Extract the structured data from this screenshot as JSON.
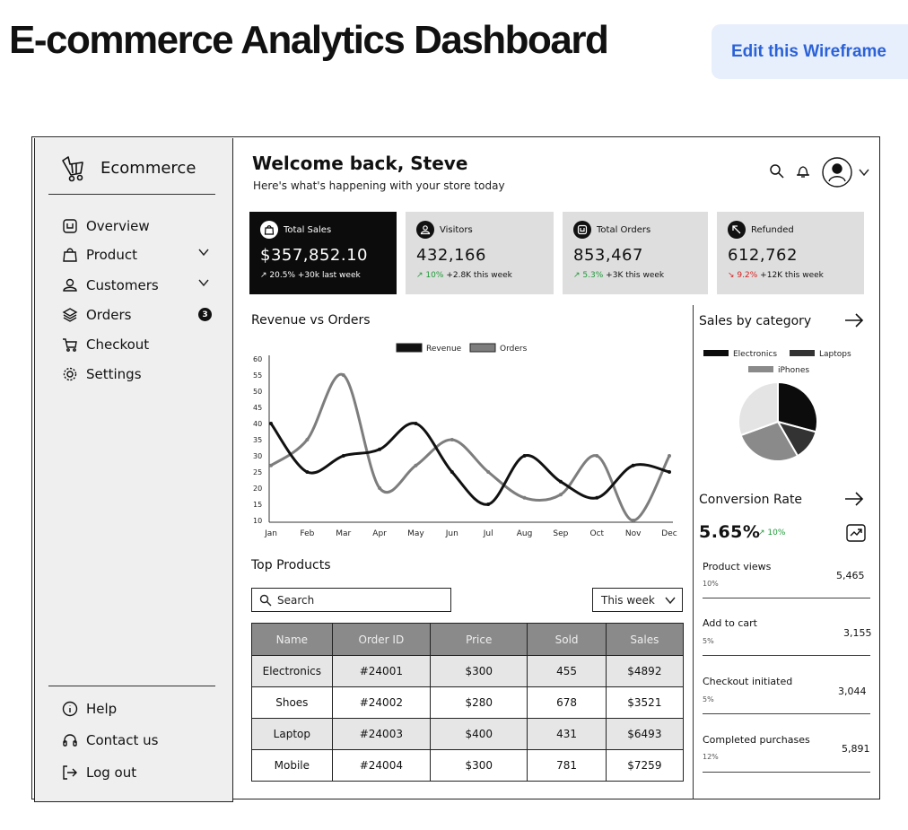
{
  "page": {
    "title": "E-commerce Analytics Dashboard",
    "edit_button": "Edit this Wireframe"
  },
  "sidebar": {
    "brand": "Ecommerce",
    "nav": [
      {
        "label": "Overview",
        "icon": "overview-icon"
      },
      {
        "label": "Product",
        "icon": "bag-icon",
        "expandable": true
      },
      {
        "label": "Customers",
        "icon": "user-icon",
        "expandable": true
      },
      {
        "label": "Orders",
        "icon": "layers-icon",
        "badge": "3"
      },
      {
        "label": "Checkout",
        "icon": "cart-icon"
      },
      {
        "label": "Settings",
        "icon": "gear-icon"
      }
    ],
    "footer": [
      {
        "label": "Help",
        "icon": "info-icon"
      },
      {
        "label": "Contact us",
        "icon": "headset-icon"
      },
      {
        "label": "Log out",
        "icon": "logout-icon"
      }
    ]
  },
  "header": {
    "welcome": "Welcome back, Steve",
    "subtitle": "Here's what's happening with your store today"
  },
  "stats": [
    {
      "label": "Total Sales",
      "value": "$357,852.10",
      "arrow": "↗",
      "pct": "20.5%",
      "delta": "+30k last week",
      "trend": "up"
    },
    {
      "label": "Visitors",
      "value": "432,166",
      "arrow": "↗",
      "pct": "10%",
      "delta": "+2.8K this week",
      "trend": "up"
    },
    {
      "label": "Total Orders",
      "value": "853,467",
      "arrow": "↗",
      "pct": "5.3%",
      "delta": "+3K this week",
      "trend": "up"
    },
    {
      "label": "Refunded",
      "value": "612,762",
      "arrow": "↘",
      "pct": "9.2%",
      "delta": "+12K this week",
      "trend": "down"
    }
  ],
  "colors": {
    "revenue": "#111111",
    "orders": "#7d7d7d",
    "up": "#1f9a39",
    "down": "#d42222",
    "accent": "#2b62d8"
  },
  "chart_data": {
    "type": "line",
    "title": "Revenue vs Orders",
    "categories": [
      "Jan",
      "Feb",
      "Mar",
      "Apr",
      "May",
      "Jun",
      "Jul",
      "Aug",
      "Sep",
      "Oct",
      "Nov",
      "Dec"
    ],
    "series": [
      {
        "name": "Revenue",
        "values": [
          40,
          25,
          30,
          32,
          40,
          25,
          15,
          30,
          22,
          17,
          27,
          25
        ]
      },
      {
        "name": "Orders",
        "values": [
          27,
          35,
          55,
          20,
          27,
          35,
          25,
          17,
          18,
          30,
          10,
          30
        ]
      }
    ],
    "yticks": [
      10,
      15,
      20,
      25,
      30,
      35,
      40,
      45,
      50,
      55,
      60
    ],
    "ylim": [
      10,
      60
    ],
    "legend": "top-center"
  },
  "category_chart": {
    "title": "Sales by category",
    "type": "pie",
    "legend": [
      "Electronics",
      "Laptops",
      "iPhones"
    ]
  },
  "conversion": {
    "title": "Conversion Rate",
    "value": "5.65%",
    "change": "↗ 10%",
    "metrics": [
      {
        "name": "Product views",
        "pct": "10%",
        "value": "5,465"
      },
      {
        "name": "Add to cart",
        "pct": "5%",
        "value": "3,155"
      },
      {
        "name": "Checkout initiated",
        "pct": "5%",
        "value": "3,044"
      },
      {
        "name": "Completed purchases",
        "pct": "12%",
        "value": "5,891"
      }
    ]
  },
  "products": {
    "title": "Top Products",
    "search_placeholder": "Search",
    "period": "This week",
    "columns": [
      "Name",
      "Order ID",
      "Price",
      "Sold",
      "Sales"
    ],
    "rows": [
      [
        "Electronics",
        "#24001",
        "$300",
        "455",
        "$4892"
      ],
      [
        "Shoes",
        "#24002",
        "$280",
        "678",
        "$3521"
      ],
      [
        "Laptop",
        "#24003",
        "$400",
        "431",
        "$6493"
      ],
      [
        "Mobile",
        "#24004",
        "$300",
        "781",
        "$7259"
      ]
    ]
  }
}
